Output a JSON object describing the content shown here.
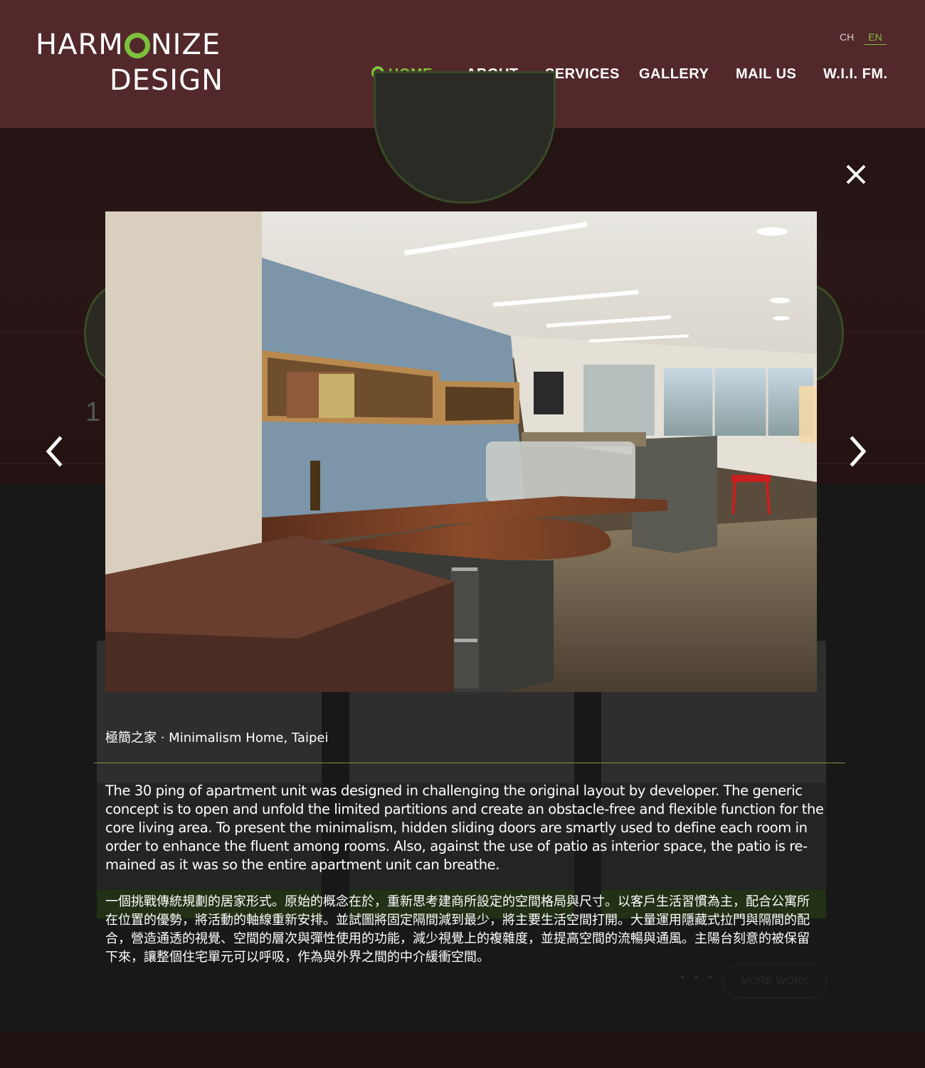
{
  "logo": {
    "line1_a": "HARM",
    "line1_b": "NIZE",
    "line2": "DESIGN"
  },
  "language": {
    "ch": "CH",
    "en": "EN",
    "active": "EN"
  },
  "nav": {
    "home": "HOME",
    "about": "ABOUT",
    "services": "SERVICES",
    "gallery": "GALLERY",
    "mail": "MAIL US",
    "wii": "W.I.I. FM."
  },
  "background": {
    "number": "1",
    "more_work": "MORE WORK",
    "dots": "• • •"
  },
  "lightbox": {
    "caption": "極簡之家 · Minimalism Home, Taipei",
    "description_en": "The 30 ping of apartment unit was designed in challenging the original layout by developer. The generic concept is to open and unfold the limited partitions and create an obstacle-free and flexible function for the core living area. To present the minimalism, hidden sliding doors are smartly used to define each room in order to enhance the fluent among rooms. Also, against the use of patio as interior space, the patio is re-mained as it was so the entire apartment unit can breathe.",
    "description_zh": "一個挑戰傳統規劃的居家形式。原始的概念在於，重新思考建商所設定的空間格局與尺寸。以客戶生活習慣為主，配合公寓所在位置的優勢，將活動的軸線重新安排。並試圖將固定隔間減到最少，將主要生活空間打開。大量運用隱藏式拉門與隔間的配合，營造通透的視覺、空間的層次與彈性使用的功能，減少視覺上的複雜度，並提高空間的流暢與通風。主陽台刻意的被保留下來，讓整個住宅單元可以呼吸，作為與外界之間的中介緩衝空間。"
  },
  "colors": {
    "header_bg": "#52282a",
    "accent_green": "#7cc13b",
    "overlay_bg": "#181818"
  },
  "icons": {
    "close": "close-icon",
    "prev": "chevron-left-icon",
    "next": "chevron-right-icon"
  }
}
